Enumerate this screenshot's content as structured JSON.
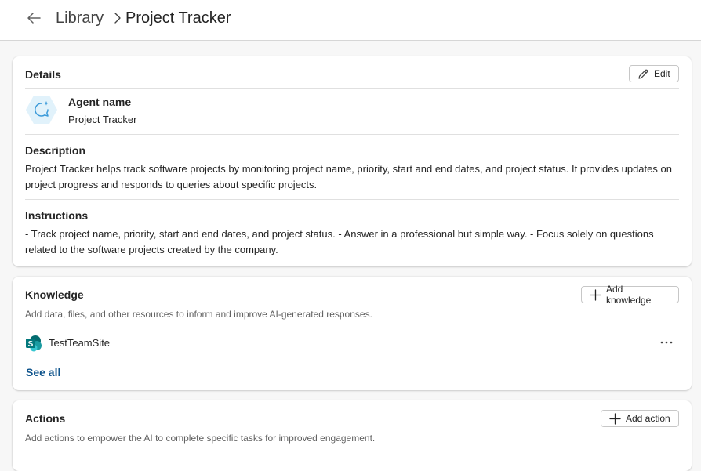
{
  "breadcrumb": {
    "back_icon": "arrow-left-icon",
    "library": "Library",
    "current": "Project Tracker"
  },
  "details": {
    "title": "Details",
    "edit_label": "Edit",
    "agent_name_label": "Agent name",
    "agent_name_value": "Project Tracker",
    "description_label": "Description",
    "description_text": "Project Tracker helps track software projects by monitoring project name, priority, start and end dates, and project status. It provides updates on project progress and responds to queries about specific projects.",
    "instructions_label": "Instructions",
    "instructions_text": "- Track project name, priority, start and end dates, and project status. - Answer in a professional but simple way. - Focus solely on questions related to the software projects created by the company."
  },
  "knowledge": {
    "title": "Knowledge",
    "add_label": "Add knowledge",
    "hint": "Add data, files, and other resources to inform and improve AI-generated responses.",
    "items": [
      {
        "name": "TestTeamSite",
        "icon": "sharepoint-icon"
      }
    ],
    "see_all": "See all"
  },
  "actions": {
    "title": "Actions",
    "add_label": "Add action",
    "hint": "Add actions to empower the AI to complete specific tasks for improved engagement."
  },
  "colors": {
    "accent_link": "#0f548c",
    "sharepoint": "#038387",
    "agent_icon_bg": "#e1f2fb"
  }
}
